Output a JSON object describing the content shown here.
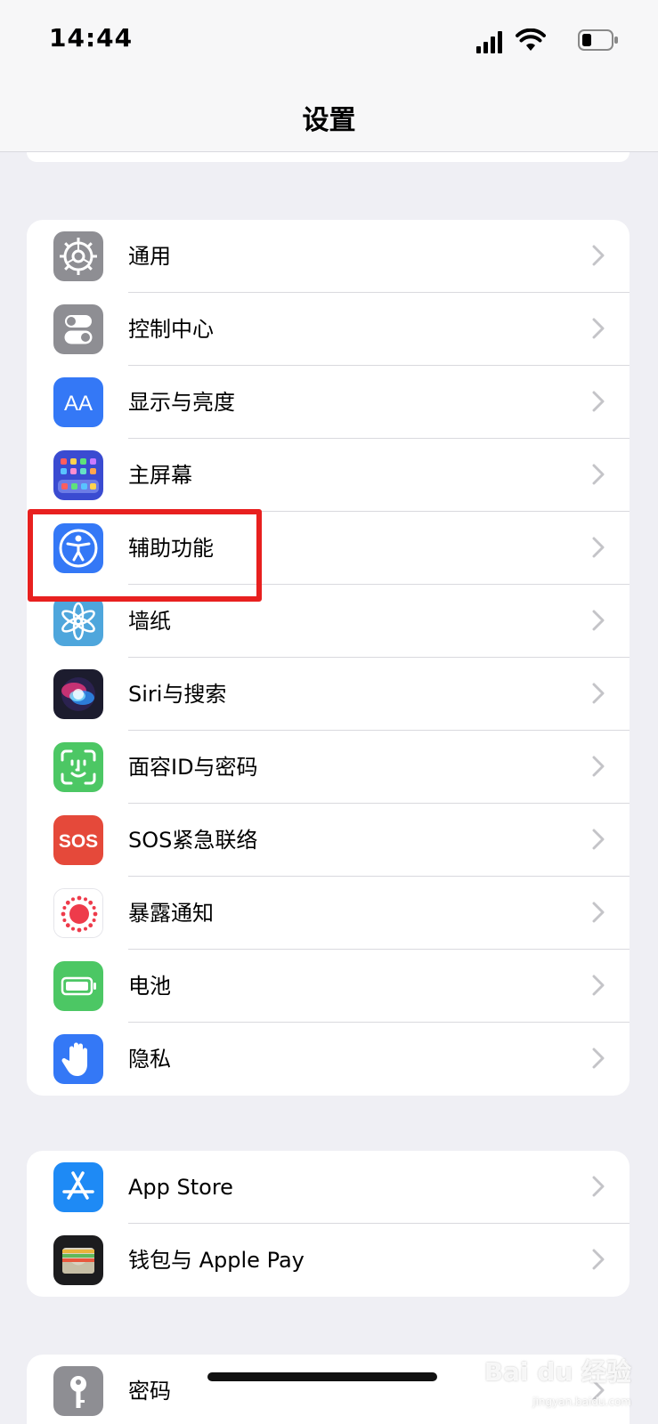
{
  "status_bar": {
    "time": "14:44"
  },
  "nav": {
    "title": "设置"
  },
  "groups": [
    {
      "items": [
        {
          "label": "通用",
          "icon": "gear-icon",
          "color": "#8e8e93"
        },
        {
          "label": "控制中心",
          "icon": "toggles-icon",
          "color": "#8e8e93"
        },
        {
          "label": "显示与亮度",
          "icon": "text-size-icon",
          "color": "#3478f6"
        },
        {
          "label": "主屏幕",
          "icon": "home-grid-icon",
          "color": "#3a4bd1"
        },
        {
          "label": "辅助功能",
          "icon": "accessibility-icon",
          "color": "#3478f6"
        },
        {
          "label": "墙纸",
          "icon": "flower-icon",
          "color": "#4ea6dc"
        },
        {
          "label": "Siri与搜索",
          "icon": "siri-icon",
          "color": "#1c1c2e"
        },
        {
          "label": "面容ID与密码",
          "icon": "face-id-icon",
          "color": "#4cc764"
        },
        {
          "label": "SOS紧急联络",
          "icon": "sos-icon",
          "color": "#e5493a"
        },
        {
          "label": "暴露通知",
          "icon": "exposure-icon",
          "color": "#ffffff"
        },
        {
          "label": "电池",
          "icon": "battery-icon",
          "color": "#4cc764"
        },
        {
          "label": "隐私",
          "icon": "hand-icon",
          "color": "#3478f6"
        }
      ]
    },
    {
      "items": [
        {
          "label": "App Store",
          "icon": "app-store-icon",
          "color": "#1e8af5"
        },
        {
          "label": "钱包与 Apple Pay",
          "icon": "wallet-icon",
          "color": "#1c1c1e"
        }
      ]
    },
    {
      "items": [
        {
          "label": "密码",
          "icon": "key-icon",
          "color": "#8e8e93"
        }
      ]
    }
  ],
  "sos_text": "SOS",
  "watermark": {
    "main": "Bai du 经验",
    "sub": "jingyan.baidu.com"
  }
}
